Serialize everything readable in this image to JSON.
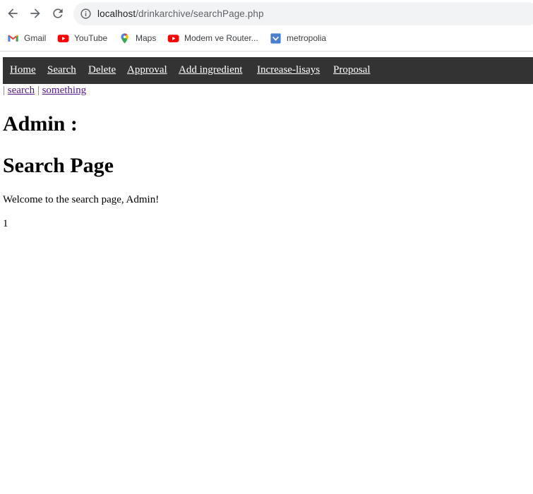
{
  "browser": {
    "url_host": "localhost",
    "url_path": "/drinkarchive/searchPage.php",
    "bookmarks": [
      {
        "label": "Gmail",
        "icon": "gmail-icon"
      },
      {
        "label": "YouTube",
        "icon": "youtube-icon"
      },
      {
        "label": "Maps",
        "icon": "maps-icon"
      },
      {
        "label": "Modem ve Router...",
        "icon": "youtube-icon"
      },
      {
        "label": "metropolia",
        "icon": "metropolia-icon"
      }
    ]
  },
  "topnav": {
    "background": "#333333",
    "items": [
      {
        "label": "Home"
      },
      {
        "label": "Search"
      },
      {
        "label": "Delete"
      },
      {
        "label": "Approval"
      },
      {
        "label": "Add ingredient "
      },
      {
        "label": "Increase-lisays"
      },
      {
        "label": "Proposal"
      }
    ]
  },
  "subnav": {
    "separator": "|",
    "links": [
      {
        "label": "search"
      },
      {
        "label": "something"
      }
    ]
  },
  "page": {
    "admin_heading": "Admin :",
    "title": "Search Page",
    "welcome": "Welcome to the search page, Admin!",
    "count": "1"
  }
}
